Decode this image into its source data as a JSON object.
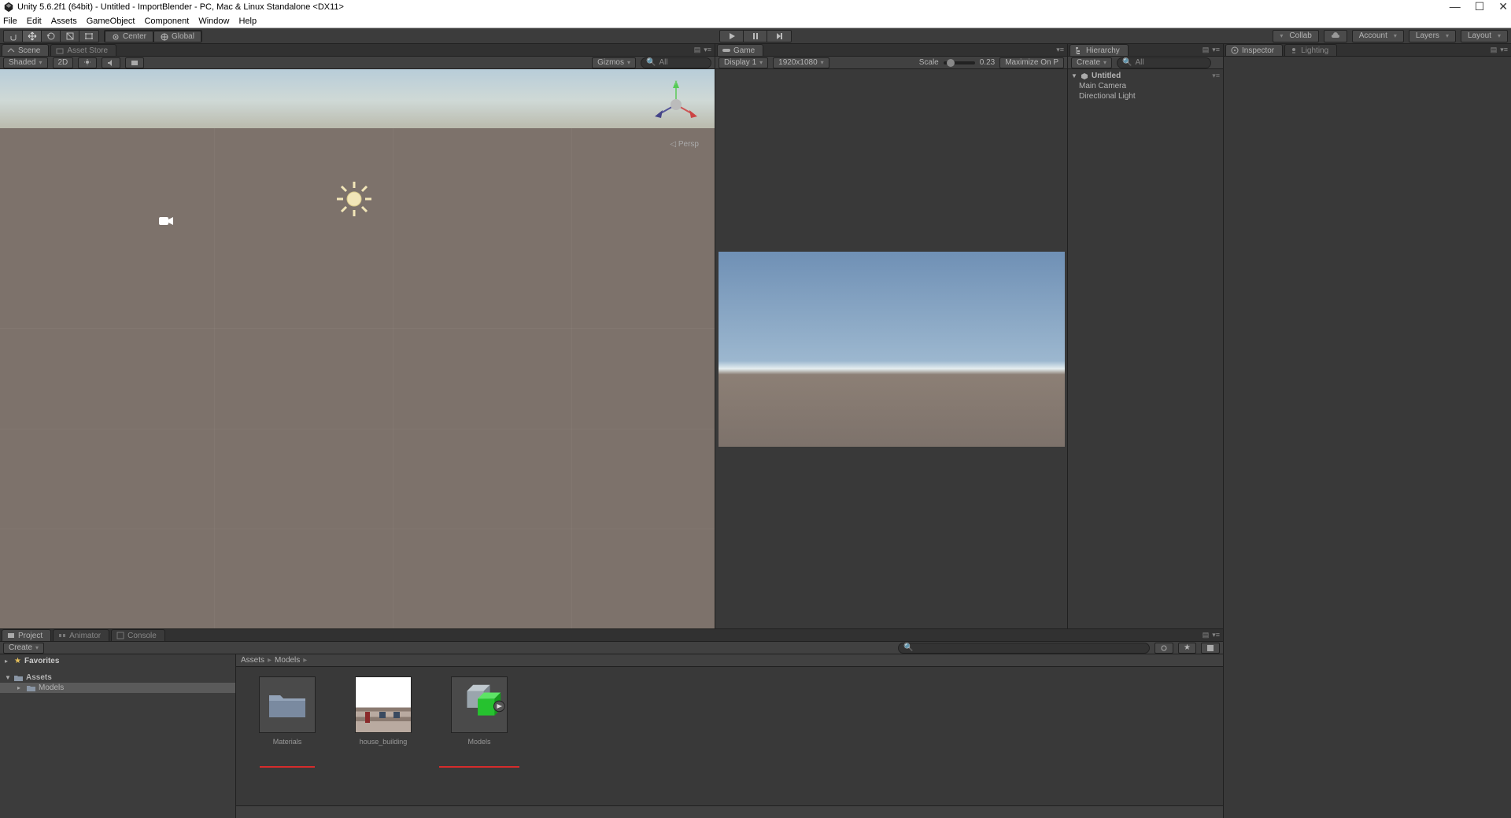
{
  "title": "Unity 5.6.2f1 (64bit) - Untitled - ImportBlender - PC, Mac & Linux Standalone <DX11>",
  "menu": [
    "File",
    "Edit",
    "Assets",
    "GameObject",
    "Component",
    "Window",
    "Help"
  ],
  "toolbar": {
    "center": "Center",
    "global": "Global",
    "collab": "Collab",
    "account": "Account",
    "layers": "Layers",
    "layout": "Layout"
  },
  "scene": {
    "tab": "Scene",
    "tab2": "Asset Store",
    "shaded": "Shaded",
    "twod": "2D",
    "gizmos": "Gizmos",
    "all": "All",
    "persp": "Persp"
  },
  "game": {
    "tab": "Game",
    "display": "Display 1",
    "res": "1920x1080",
    "scale_lbl": "Scale",
    "scale_val": "0.23",
    "max": "Maximize On P"
  },
  "hierarchy": {
    "tab": "Hierarchy",
    "create": "Create",
    "all": "All",
    "root": "Untitled",
    "items": [
      "Main Camera",
      "Directional Light"
    ]
  },
  "inspector": {
    "tab": "Inspector",
    "tab2": "Lighting"
  },
  "project": {
    "tab": "Project",
    "tab_anim": "Animator",
    "tab_cons": "Console",
    "create": "Create",
    "fav": "Favorites",
    "assets": "Assets",
    "models": "Models",
    "crumb1": "Assets",
    "crumb2": "Models",
    "items": [
      {
        "name": "Materials",
        "type": "folder"
      },
      {
        "name": "house_building",
        "type": "image"
      },
      {
        "name": "Models",
        "type": "prefab"
      }
    ]
  }
}
